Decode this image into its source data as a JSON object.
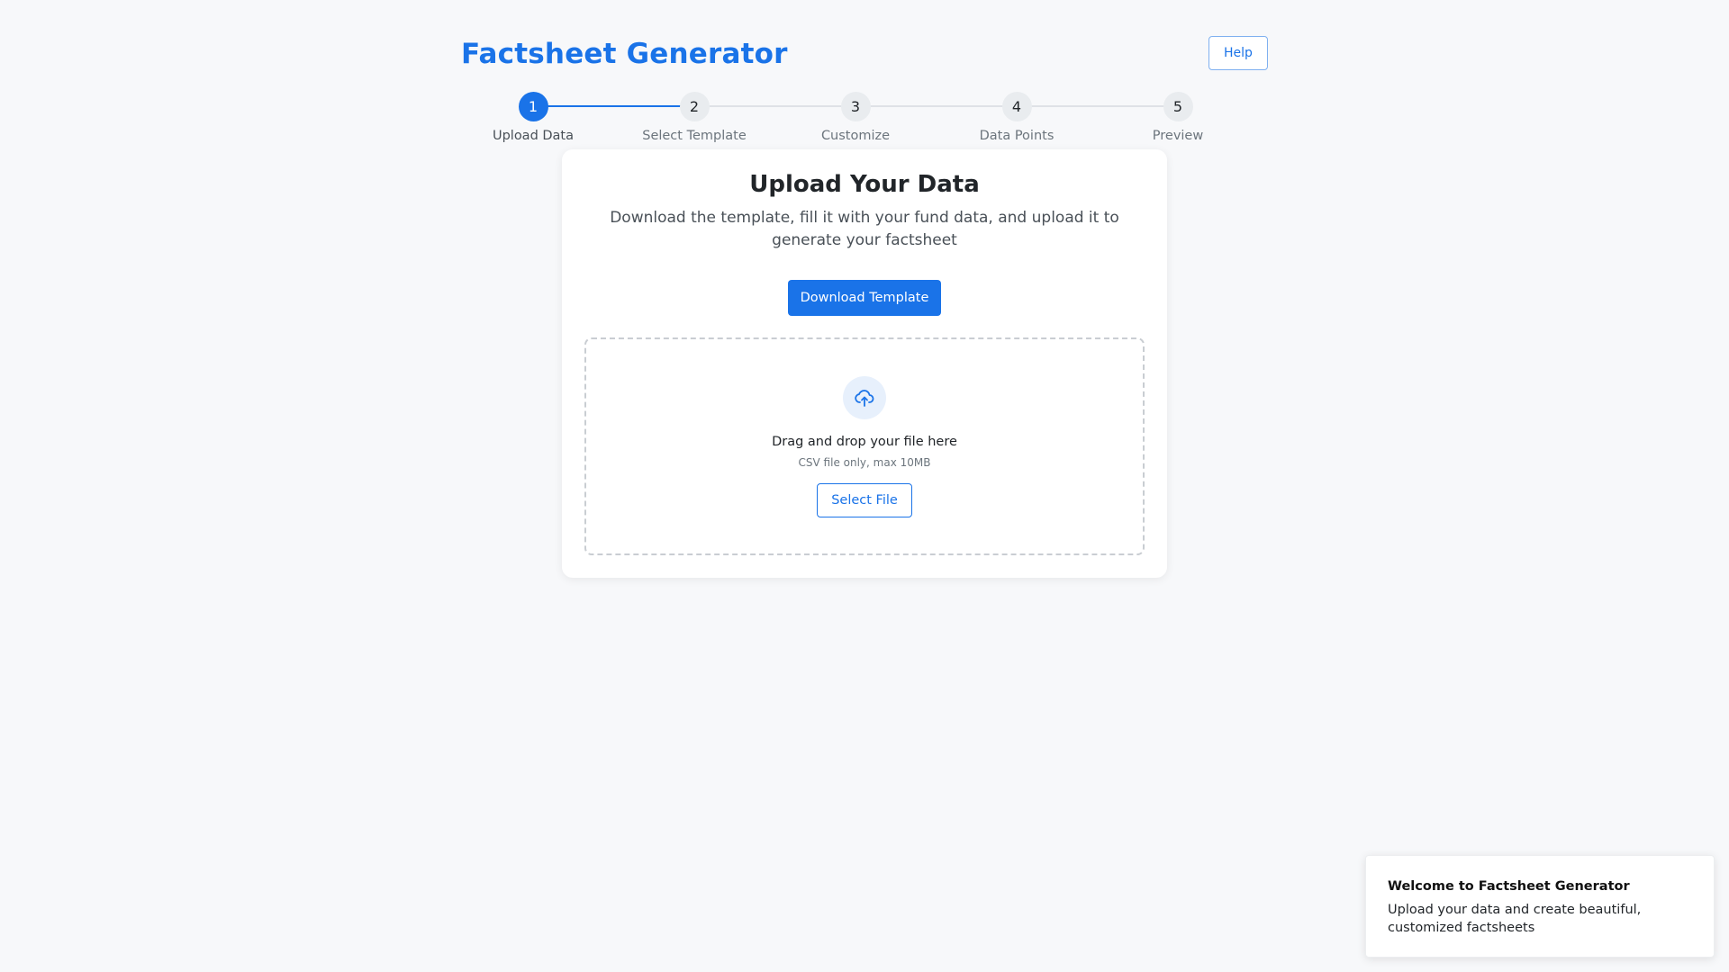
{
  "header": {
    "title": "Factsheet Generator",
    "help_label": "Help"
  },
  "stepper": {
    "current_step": 1,
    "steps": [
      {
        "number": "1",
        "label": "Upload Data"
      },
      {
        "number": "2",
        "label": "Select Template"
      },
      {
        "number": "3",
        "label": "Customize"
      },
      {
        "number": "4",
        "label": "Data Points"
      },
      {
        "number": "5",
        "label": "Preview"
      }
    ]
  },
  "upload_card": {
    "title": "Upload Your Data",
    "description": "Download the template, fill it with your fund data, and upload it to generate your factsheet",
    "download_label": "Download Template",
    "dropzone": {
      "icon": "cloud-upload-icon",
      "title": "Drag and drop your file here",
      "subtitle": "CSV file only, max 10MB",
      "select_label": "Select File"
    }
  },
  "toast": {
    "title": "Welcome to Factsheet Generator",
    "message": "Upload your data and create beautiful, customized factsheets"
  },
  "colors": {
    "primary": "#1a73e8",
    "background": "#f7f8fa",
    "inactive_step": "#e9ecef",
    "icon_bg": "#e7f0fc"
  }
}
